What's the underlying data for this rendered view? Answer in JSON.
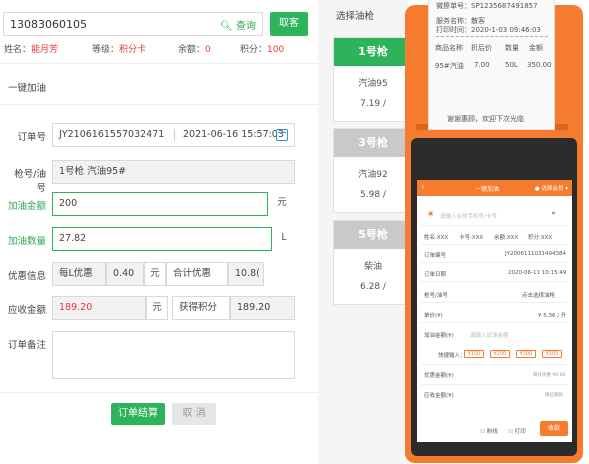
{
  "member": {
    "phone": "13083060105",
    "query_label": "查询",
    "take_label": "取客",
    "name_label": "姓名：",
    "name": "能月芳",
    "level_label": "等级：",
    "level": "积分卡",
    "balance_label": "余额：",
    "balance": "0",
    "points_label": "积分：",
    "points": "100"
  },
  "section_title": "一键加油",
  "form": {
    "order_no_label": "订单号",
    "order_no": "JY2106161557032471",
    "order_time": "2021-06-16 15:57:03",
    "gun_label": "枪号/油号",
    "gun": "1号枪 汽油95#",
    "amount_label": "加油金额",
    "amount": "200",
    "amount_unit": "元",
    "qty_label": "加油数量",
    "qty": "27.82",
    "qty_unit": "L",
    "discount_label": "优惠信息",
    "per_l_label": "每L优惠",
    "per_l_value": "0.40",
    "per_l_unit": "元",
    "total_disc_label": "合计优惠",
    "total_disc_value": "10.8(",
    "receivable_label": "应收金额",
    "receivable": "189.20",
    "receivable_unit": "元",
    "earn_points_label": "获得积分",
    "earn_points": "189.20",
    "remark_label": "订单备注",
    "settle_label": "订单结算",
    "cancel_label": "取 消"
  },
  "nozzles": {
    "title": "选择油枪",
    "items": [
      {
        "head": "1号枪",
        "fuel": "汽油95",
        "price": "7.19 /",
        "color": "#2db45b"
      },
      {
        "head": "3号枪",
        "fuel": "汽油92",
        "price": "5.98 /",
        "color": "#c9c9c9"
      },
      {
        "head": "5号枪",
        "fuel": "柴油",
        "price": "6.28 /",
        "color": "#c9c9c9"
      }
    ]
  },
  "receipt": {
    "line1": "微擦单号：SP1235687491857",
    "line2": "服务名称：散客",
    "line3": "打印时间：2020-1-03  09:46:03",
    "h_name": "商品名称",
    "h_price": "折后价",
    "h_qty": "数量",
    "h_amount": "金额",
    "r_name": "95#汽油",
    "r_price": "7.00",
    "r_qty": "50L",
    "r_amount": "350.00",
    "thanks": "谢谢惠顾，欢迎下次光临"
  },
  "device_screen": {
    "title": "一键加油",
    "member_btn": "选择会员",
    "search_placeholder": "请输入会员手机号/卡号",
    "name": "姓名:XXX",
    "card": "卡号:XXX",
    "balance": "余额:XXX",
    "points": "积分:XXX",
    "order_label": "订单编号",
    "order_value": "JY2006111031494384",
    "date_label": "订单日期",
    "date_value": "2020-06-11 10:15:49",
    "gun_label": "枪号/油号",
    "gun_value": "点击选择油枪",
    "price_label": "单价(¥)",
    "price_value": "¥ 5.36 / 升",
    "amount_label": "加油金额(¥)",
    "amount_placeholder": "请输入加油金额",
    "quick_label": "快捷输入：",
    "quick": [
      "¥100",
      "¥200",
      "¥300",
      "¥500"
    ],
    "discount_label": "优惠金额(¥)",
    "discount_note": "每升优惠 ¥0.00",
    "receivable_label": "应收金额(¥)",
    "receivable_note": "微信收款",
    "check1": "粉线",
    "check2": "打印",
    "collect": "收款",
    "accent": "#f57c2f"
  }
}
